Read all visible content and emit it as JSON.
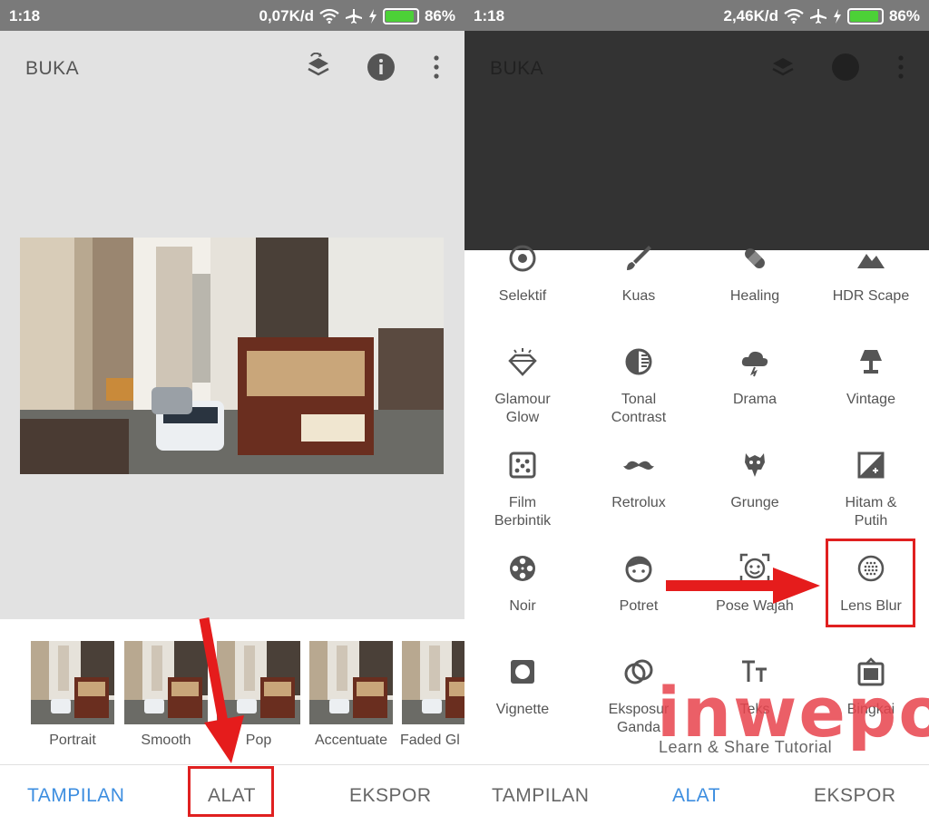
{
  "left": {
    "status": {
      "time": "1:18",
      "speed": "0,07K/d",
      "battery": "86%",
      "battery_level": 0.86
    },
    "appbar": {
      "title": "BUKA"
    },
    "filters": [
      {
        "label": "Portrait"
      },
      {
        "label": "Smooth"
      },
      {
        "label": "Pop"
      },
      {
        "label": "Accentuate"
      },
      {
        "label": "Faded Gl"
      }
    ],
    "nav": {
      "tab1": "TAMPILAN",
      "tab2": "ALAT",
      "tab3": "EKSPOR",
      "active": "TAMPILAN"
    }
  },
  "right": {
    "status": {
      "time": "1:18",
      "speed": "2,46K/d",
      "battery": "86%",
      "battery_level": 0.86
    },
    "appbar": {
      "title": "BUKA"
    },
    "tools": [
      {
        "label": "Selektif",
        "icon": "target-icon"
      },
      {
        "label": "Kuas",
        "icon": "brush-icon"
      },
      {
        "label": "Healing",
        "icon": "bandage-icon"
      },
      {
        "label": "HDR Scape",
        "icon": "mountain-icon"
      },
      {
        "label": "Glamour\nGlow",
        "icon": "diamond-icon"
      },
      {
        "label": "Tonal\nContrast",
        "icon": "tonal-icon"
      },
      {
        "label": "Drama",
        "icon": "cloud-icon"
      },
      {
        "label": "Vintage",
        "icon": "lamp-icon"
      },
      {
        "label": "Film\nBerbintik",
        "icon": "grain-icon"
      },
      {
        "label": "Retrolux",
        "icon": "mustache-icon"
      },
      {
        "label": "Grunge",
        "icon": "grunge-icon"
      },
      {
        "label": "Hitam &\nPutih",
        "icon": "bw-icon"
      },
      {
        "label": "Noir",
        "icon": "film-reel-icon"
      },
      {
        "label": "Potret",
        "icon": "face-icon"
      },
      {
        "label": "Pose Wajah",
        "icon": "face-pose-icon"
      },
      {
        "label": "Lens Blur",
        "icon": "lens-blur-icon"
      },
      {
        "label": "Vignette",
        "icon": "vignette-icon"
      },
      {
        "label": "Eksposur\nGanda",
        "icon": "double-exposure-icon"
      },
      {
        "label": "Teks",
        "icon": "text-icon"
      },
      {
        "label": "Bingkai",
        "icon": "frame-icon"
      }
    ],
    "nav": {
      "tab1": "TAMPILAN",
      "tab2": "ALAT",
      "tab3": "EKSPOR",
      "active": "ALAT"
    }
  },
  "watermark": {
    "brand": "inwepo",
    "tagline": "Learn & Share Tutorial"
  },
  "colors": {
    "accent": "#3d8ee0",
    "highlight": "#e02020",
    "watermark": "#e8444d"
  }
}
